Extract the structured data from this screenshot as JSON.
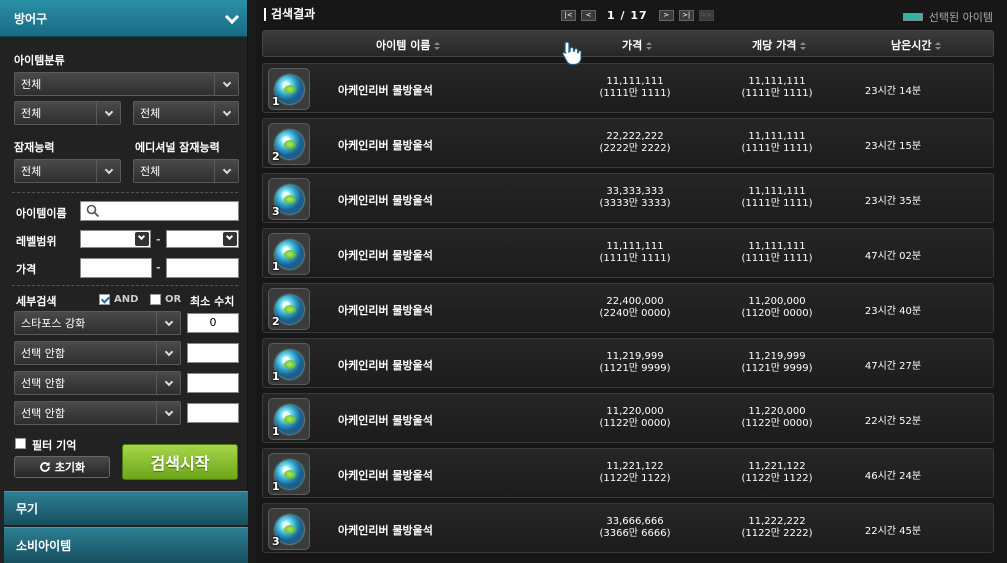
{
  "sidebar": {
    "category_open": "방어구",
    "categories_below": [
      "무기",
      "소비아이템"
    ],
    "labels": {
      "item_category": "아이템분류",
      "potential": "잠재능력",
      "additional_potential": "에디셔널 잠재능력",
      "item_name": "아이템이름",
      "level_range": "레벨범위",
      "price": "가격",
      "detail_search": "세부검색",
      "min_value": "최소 수치",
      "filter_memory": "필터 기억",
      "range_sep": "-"
    },
    "selects": {
      "category_main": "전체",
      "category_sub1": "전체",
      "category_sub2": "전체",
      "potential": "전체",
      "additional_potential": "전체"
    },
    "checks": {
      "and": "AND",
      "or": "OR"
    },
    "detail_rows": [
      {
        "option": "스타포스 강화",
        "value": "0"
      },
      {
        "option": "선택 안함",
        "value": ""
      },
      {
        "option": "선택 안함",
        "value": ""
      },
      {
        "option": "선택 안함",
        "value": ""
      }
    ],
    "buttons": {
      "reset": "초기화",
      "search": "검색시작"
    }
  },
  "results": {
    "title": "검색결과",
    "pager": {
      "current": "1",
      "sep": "/",
      "total": "17",
      "first": "|<",
      "prev": "<",
      "next": ">",
      "last": ">|",
      "next_block": ">>"
    },
    "legend": "선택된 아이템",
    "columns": {
      "name": "아이템 이름",
      "price": "가격",
      "unit_price": "개당 가격",
      "time_left": "남은시간"
    },
    "rows": [
      {
        "qty": "1",
        "name": "아케인리버 물방울석",
        "price": "11,111,111",
        "price_kr": "(1111만 1111)",
        "unit": "11,111,111",
        "unit_kr": "(1111만 1111)",
        "time": "23시간 14분"
      },
      {
        "qty": "2",
        "name": "아케인리버 물방울석",
        "price": "22,222,222",
        "price_kr": "(2222만 2222)",
        "unit": "11,111,111",
        "unit_kr": "(1111만 1111)",
        "time": "23시간 15분"
      },
      {
        "qty": "3",
        "name": "아케인리버 물방울석",
        "price": "33,333,333",
        "price_kr": "(3333만 3333)",
        "unit": "11,111,111",
        "unit_kr": "(1111만 1111)",
        "time": "23시간 35분"
      },
      {
        "qty": "1",
        "name": "아케인리버 물방울석",
        "price": "11,111,111",
        "price_kr": "(1111만 1111)",
        "unit": "11,111,111",
        "unit_kr": "(1111만 1111)",
        "time": "47시간 02분"
      },
      {
        "qty": "2",
        "name": "아케인리버 물방울석",
        "price": "22,400,000",
        "price_kr": "(2240만 0000)",
        "unit": "11,200,000",
        "unit_kr": "(1120만 0000)",
        "time": "23시간 40분"
      },
      {
        "qty": "1",
        "name": "아케인리버 물방울석",
        "price": "11,219,999",
        "price_kr": "(1121만 9999)",
        "unit": "11,219,999",
        "unit_kr": "(1121만 9999)",
        "time": "47시간 27분"
      },
      {
        "qty": "1",
        "name": "아케인리버 물방울석",
        "price": "11,220,000",
        "price_kr": "(1122만 0000)",
        "unit": "11,220,000",
        "unit_kr": "(1122만 0000)",
        "time": "22시간 52분"
      },
      {
        "qty": "1",
        "name": "아케인리버 물방울석",
        "price": "11,221,122",
        "price_kr": "(1122만 1122)",
        "unit": "11,221,122",
        "unit_kr": "(1122만 1122)",
        "time": "46시간 24분"
      },
      {
        "qty": "3",
        "name": "아케인리버 물방울석",
        "price": "33,666,666",
        "price_kr": "(3366만 6666)",
        "unit": "11,222,222",
        "unit_kr": "(1122만 2222)",
        "time": "22시간 45분"
      }
    ]
  },
  "colors": {
    "accent": "#2b90a9",
    "search_button": "#8cc43a",
    "legend_swatch": "#34b3a5"
  }
}
